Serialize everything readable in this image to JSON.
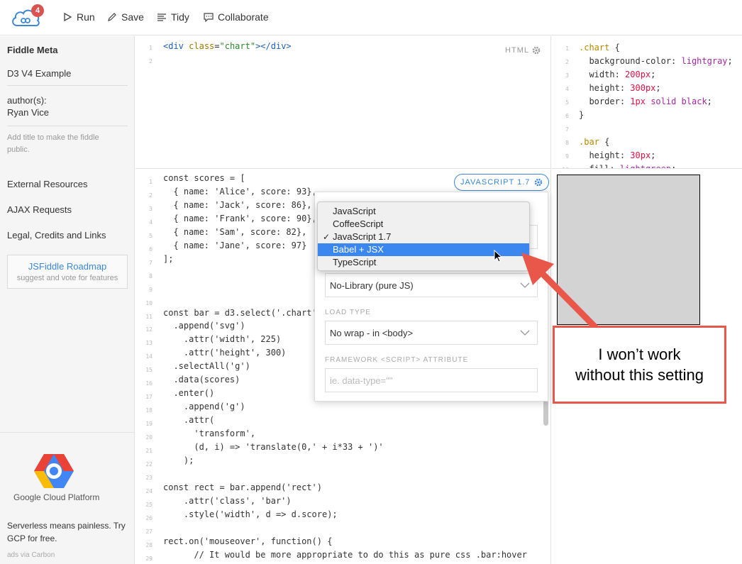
{
  "topbar": {
    "notification_count": "4",
    "run_label": "Run",
    "save_label": "Save",
    "tidy_label": "Tidy",
    "collaborate_label": "Collaborate"
  },
  "sidebar": {
    "title": "Fiddle Meta",
    "fiddle_name": "D3 V4 Example",
    "authors_label": "author(s):",
    "author_name": "Ryan Vice",
    "hint": "Add title to make the fiddle public.",
    "links": [
      "External Resources",
      "AJAX Requests",
      "Legal, Credits and Links"
    ],
    "roadmap_title": "JSFiddle Roadmap",
    "roadmap_sub": "suggest and vote for features",
    "ad_brand": "Google Cloud Platform",
    "ad_text": "Serverless means painless. Try GCP for free.",
    "ad_via": "ads via Carbon"
  },
  "html_pane": {
    "label": "HTML",
    "line_numbers": [
      "1",
      "2"
    ]
  },
  "js_pane": {
    "label": "JAVASCRIPT 1.7",
    "line_numbers": [
      "1",
      "2",
      "3",
      "4",
      "5",
      "6",
      "7",
      "8",
      "9",
      "10",
      "11",
      "12",
      "13",
      "14",
      "15",
      "16",
      "17",
      "18",
      "19",
      "20",
      "21",
      "22",
      "23",
      "24",
      "25",
      "26",
      "27",
      "28",
      "29"
    ],
    "lines": [
      "const scores = [",
      "  { name: 'Alice', score: 93},",
      "  { name: 'Jack', score: 86},",
      "  { name: 'Frank', score: 90},",
      "  { name: 'Sam', score: 82},",
      "  { name: 'Jane', score: 97}",
      "];",
      "",
      "",
      "",
      "const bar = d3.select('.chart')",
      "  .append('svg')",
      "    .attr('width', 225)",
      "    .attr('height', 300)",
      "  .selectAll('g')",
      "  .data(scores)",
      "  .enter()",
      "    .append('g')",
      "    .attr(",
      "      'transform',",
      "      (d, i) => 'translate(0,' + i*33 + ')'",
      "    );",
      "",
      "const rect = bar.append('rect')",
      "    .attr('class', 'bar')",
      "    .style('width', d => d.score);",
      "",
      "rect.on('mouseover', function() {",
      "      // It would be more appropriate to do this as pure css .bar:hover"
    ]
  },
  "css_pane": {
    "line_numbers": [
      "1",
      "2",
      "3",
      "4",
      "5",
      "6",
      "7",
      "8",
      "9",
      "10"
    ]
  },
  "settings": {
    "framework_label": "FRAMEWORKS & EXTENSIONS",
    "framework_value": "No-Library (pure JS)",
    "load_type_label": "LOAD TYPE",
    "load_type_value": "No wrap - in <body>",
    "attribute_label": "FRAMEWORK <SCRIPT> ATTRIBUTE",
    "attribute_placeholder": "ie. data-type=\"\""
  },
  "dropdown": {
    "options": [
      "JavaScript",
      "CoffeeScript",
      "JavaScript 1.7",
      "Babel + JSX",
      "TypeScript"
    ],
    "checked": "JavaScript 1.7",
    "highlighted": "Babel + JSX"
  },
  "annotation": {
    "line1": "I won’t work",
    "line2": "without this setting",
    "color": "#e8574a"
  }
}
